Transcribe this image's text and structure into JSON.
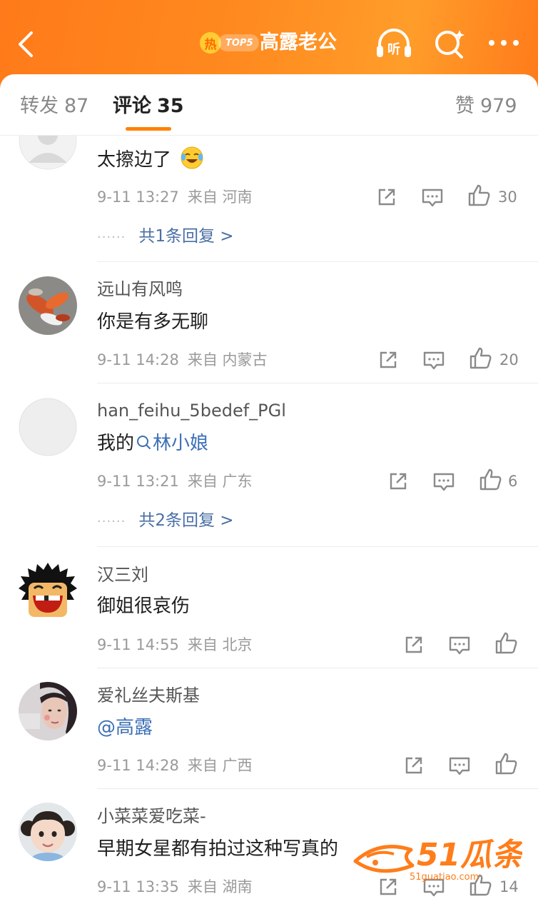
{
  "header": {
    "hot_rank_icon": "热",
    "hot_rank_text": "TOP5",
    "topic": "高露老公",
    "listen_label": "听",
    "accent_color": "#ff8200"
  },
  "tabs": [
    {
      "label": "转发",
      "count": "87"
    },
    {
      "label": "评论",
      "count": "35"
    },
    {
      "label": "赞",
      "count": "979"
    }
  ],
  "comments": [
    {
      "username": "",
      "text": "太擦边了",
      "emoji": "laughing-crying-emoji",
      "time": "9-11 13:27",
      "from_label": "来自",
      "location": "河南",
      "likes": "30",
      "replies": "共1条回复 >"
    },
    {
      "username": "远山有风鸣",
      "text": "你是有多无聊",
      "time": "9-11 14:28",
      "from_label": "来自",
      "location": "内蒙古",
      "likes": "20"
    },
    {
      "username": "han_feihu_5bedef_PGl",
      "text_prefix": "我的",
      "search_link": "林小娘",
      "time": "9-11 13:21",
      "from_label": "来自",
      "location": "广东",
      "likes": "6",
      "replies": "共2条回复 >"
    },
    {
      "username": "汉三刘",
      "text": "御姐很哀伤",
      "time": "9-11 14:55",
      "from_label": "来自",
      "location": "北京",
      "likes": ""
    },
    {
      "username": "爱礼丝夫斯基",
      "mention": "@高露",
      "time": "9-11 14:28",
      "from_label": "来自",
      "location": "广西",
      "likes": ""
    },
    {
      "username": "小菜菜爱吃菜-",
      "text": "早期女星都有拍过这种写真的",
      "time": "9-11 13:35",
      "from_label": "来自",
      "location": "湖南",
      "likes": "14"
    }
  ],
  "watermark": {
    "brand": "51瓜条",
    "url": "51guatiao.com"
  }
}
